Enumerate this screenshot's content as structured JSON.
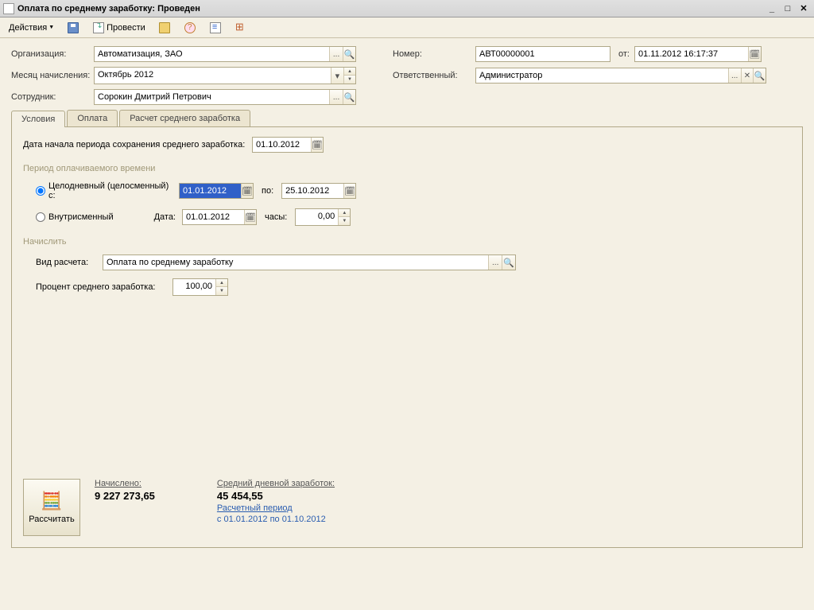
{
  "window": {
    "title": "Оплата по среднему заработку: Проведен"
  },
  "toolbar": {
    "actions": "Действия",
    "post": "Провести"
  },
  "header": {
    "org_label": "Организация:",
    "org_value": "Автоматизация, ЗАО",
    "month_label": "Месяц начисления:",
    "month_value": "Октябрь 2012",
    "employee_label": "Сотрудник:",
    "employee_value": "Сорокин Дмитрий Петрович",
    "number_label": "Номер:",
    "number_value": "АВТ00000001",
    "from_label": "от:",
    "from_value": "01.11.2012 16:17:37",
    "responsible_label": "Ответственный:",
    "responsible_value": "Администратор"
  },
  "tabs": {
    "t1": "Условия",
    "t2": "Оплата",
    "t3": "Расчет среднего заработка"
  },
  "cond": {
    "start_date_label": "Дата начала периода сохранения среднего заработка:",
    "start_date_value": "01.10.2012",
    "period_title": "Период оплачиваемого времени",
    "radio_daily": "Целодневный (целосменный) с:",
    "daily_from": "01.01.2012",
    "to_label": "по:",
    "daily_to": "25.10.2012",
    "radio_intra": "Внутрисменный",
    "date_label": "Дата:",
    "intra_date": "01.01.2012",
    "hours_label": "часы:",
    "hours_value": "0,00",
    "accrue_title": "Начислить",
    "calc_type_label": "Вид расчета:",
    "calc_type_value": "Оплата по среднему заработку",
    "percent_label": "Процент среднего заработка:",
    "percent_value": "100,00"
  },
  "footer": {
    "calc_btn": "Рассчитать",
    "accrued_label": "Начислено:",
    "accrued_value": "9 227 273,65",
    "avg_label": "Средний дневной заработок:",
    "avg_value": "45 454,55",
    "period_link": "Расчетный период",
    "period_text": " с 01.01.2012 по 01.10.2012"
  }
}
